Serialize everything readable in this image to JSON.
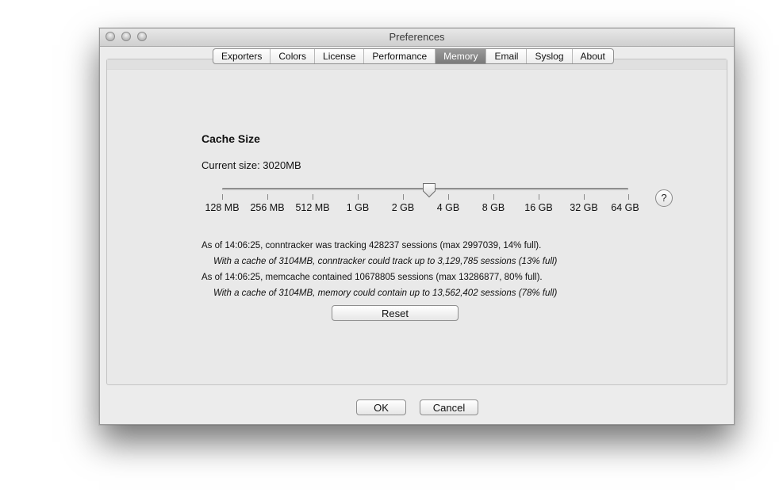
{
  "window": {
    "title": "Preferences"
  },
  "tabs": [
    {
      "label": "Exporters"
    },
    {
      "label": "Colors"
    },
    {
      "label": "License"
    },
    {
      "label": "Performance"
    },
    {
      "label": "Memory",
      "selected": true
    },
    {
      "label": "Email"
    },
    {
      "label": "Syslog"
    },
    {
      "label": "About"
    }
  ],
  "memory": {
    "section_title": "Cache Size",
    "current_size": "Current size: 3020MB",
    "slider": {
      "ticks": [
        "128 MB",
        "256 MB",
        "512 MB",
        "1 GB",
        "2 GB",
        "4 GB",
        "8 GB",
        "16 GB",
        "32 GB",
        "64 GB"
      ],
      "value": "3020MB"
    },
    "help_label": "?",
    "stats": {
      "line1": "As of 14:06:25, conntracker was tracking 428237 sessions (max 2997039, 14% full).",
      "line2": "With a cache of 3104MB, conntracker could track up to 3,129,785 sessions (13% full)",
      "line3": "As of 14:06:25, memcache contained 10678805 sessions (max 13286877, 80% full).",
      "line4": "With a cache of 3104MB, memory could contain up to 13,562,402 sessions (78% full)"
    },
    "reset_label": "Reset"
  },
  "footer": {
    "ok_label": "OK",
    "cancel_label": "Cancel"
  }
}
